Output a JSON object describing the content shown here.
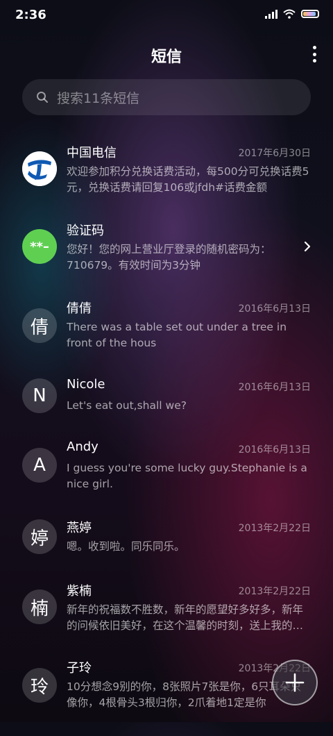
{
  "status_bar": {
    "time": "2:36"
  },
  "header": {
    "title": "短信"
  },
  "search": {
    "placeholder": "搜索11条短信"
  },
  "conversations": [
    {
      "name": "中国电信",
      "date": "2017年6月30日",
      "preview": "欢迎参加积分兑换话费活动，每500分可兑换话费5元，兑换话费请回复106或jfdh#话费金额",
      "avatar": "china-telecom-logo"
    },
    {
      "name": "验证码",
      "date": "",
      "preview": "您好！您的网上营业厅登录的随机密码为：710679。有效时间为3分钟",
      "avatar_text": "**–",
      "avatar_color": "#5fcf52"
    },
    {
      "name": "倩倩",
      "date": "2016年6月13日",
      "preview": "There was a table set out under a tree in front of the hous",
      "avatar_text": "倩"
    },
    {
      "name": "Nicole",
      "date": "2016年6月13日",
      "preview": "Let's eat out,shall we?",
      "avatar_text": "N"
    },
    {
      "name": "Andy",
      "date": "2016年6月13日",
      "preview": "I guess you're some lucky guy.Stephanie is a nice girl.",
      "avatar_text": "A"
    },
    {
      "name": "燕婷",
      "date": "2013年2月22日",
      "preview": "嗯。收到啦。同乐同乐。",
      "avatar_text": "婷"
    },
    {
      "name": "紫楠",
      "date": "2013年2月22日",
      "preview": "新年的祝福数不胜数，新年的愿望好多好多，新年的问候依旧美好，在这个温馨的时刻，送上我的祝福",
      "avatar_text": "楠"
    },
    {
      "name": "子玲",
      "date": "2013年2月22日",
      "preview": "10分想念9别的你，8张照片7张是你，6只耳朵只像你，4根骨头3根归你，2爪着地1定是你",
      "avatar_text": "玲"
    }
  ],
  "colors": {
    "accent_green": "#5fcf52",
    "telecom_blue": "#0f5ab3"
  }
}
